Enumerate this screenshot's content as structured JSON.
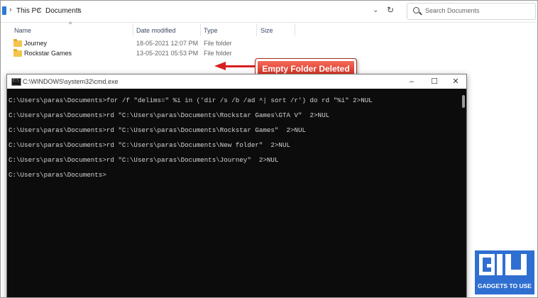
{
  "explorer": {
    "breadcrumb": [
      "This PC",
      "Documents"
    ],
    "search_placeholder": "Search Documents",
    "columns": [
      "Name",
      "Date modified",
      "Type",
      "Size"
    ],
    "files": [
      {
        "name": "Journey",
        "date": "18-05-2021 12:07 PM",
        "type": "File folder"
      },
      {
        "name": "Rockstar Games",
        "date": "13-05-2021 05:53 PM",
        "type": "File folder"
      }
    ]
  },
  "annotation": {
    "text": "Empty Folder Deleted",
    "color": "#d81e1e"
  },
  "cmd": {
    "title": "C:\\WINDOWS\\system32\\cmd.exe",
    "lines": [
      "C:\\Users\\paras\\Documents>for /f \"delims=\" %i in ('dir /s /b /ad ^| sort /r') do rd \"%i\" 2>NUL",
      "C:\\Users\\paras\\Documents>rd \"C:\\Users\\paras\\Documents\\Rockstar Games\\GTA V\"  2>NUL",
      "C:\\Users\\paras\\Documents>rd \"C:\\Users\\paras\\Documents\\Rockstar Games\"  2>NUL",
      "C:\\Users\\paras\\Documents>rd \"C:\\Users\\paras\\Documents\\New folder\"  2>NUL",
      "C:\\Users\\paras\\Documents>rd \"C:\\Users\\paras\\Documents\\Journey\"  2>NUL",
      "C:\\Users\\paras\\Documents>"
    ]
  },
  "logo": {
    "caption": "GADGETS TO USE",
    "color": "#2f6fd1"
  }
}
